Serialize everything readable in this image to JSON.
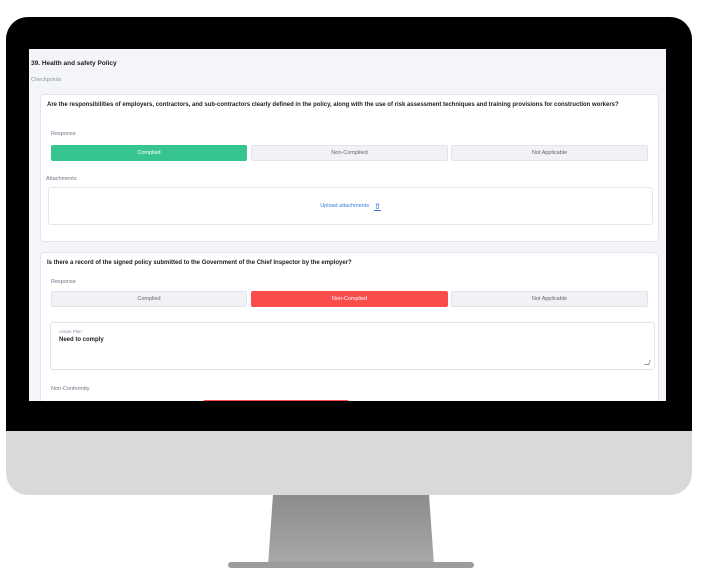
{
  "section": {
    "title": "39. Health and safety Policy",
    "subtitle": "Checkpoints"
  },
  "q1": {
    "text": "Are the responsibilities of employers, contractors, and sub-contractors clearly defined in the policy, along with the use of risk assessment techniques and training provisions for construction workers?",
    "response_label": "Response",
    "options": [
      "Complied",
      "Non-Compliied",
      "Not Applicable"
    ],
    "selected": "Complied",
    "attachments_label": "Attachments",
    "upload_label": "Upload attachments",
    "upload_icon": "⇧"
  },
  "q2": {
    "text": "Is there a record of the signed policy submitted to the Government of the Chief Inspector by the employer?",
    "response_label": "Response",
    "options": [
      "Complied",
      "Non-Complied",
      "Not Applicable"
    ],
    "selected": "Non-Complied",
    "action_plan_label": "Action Plan",
    "action_plan_value": "Need to comply",
    "nonconformity_label": "Non-Conformity"
  },
  "colors": {
    "complied": "#36c58e",
    "noncomplied": "#fb4c4c",
    "link": "#3d7be0"
  }
}
